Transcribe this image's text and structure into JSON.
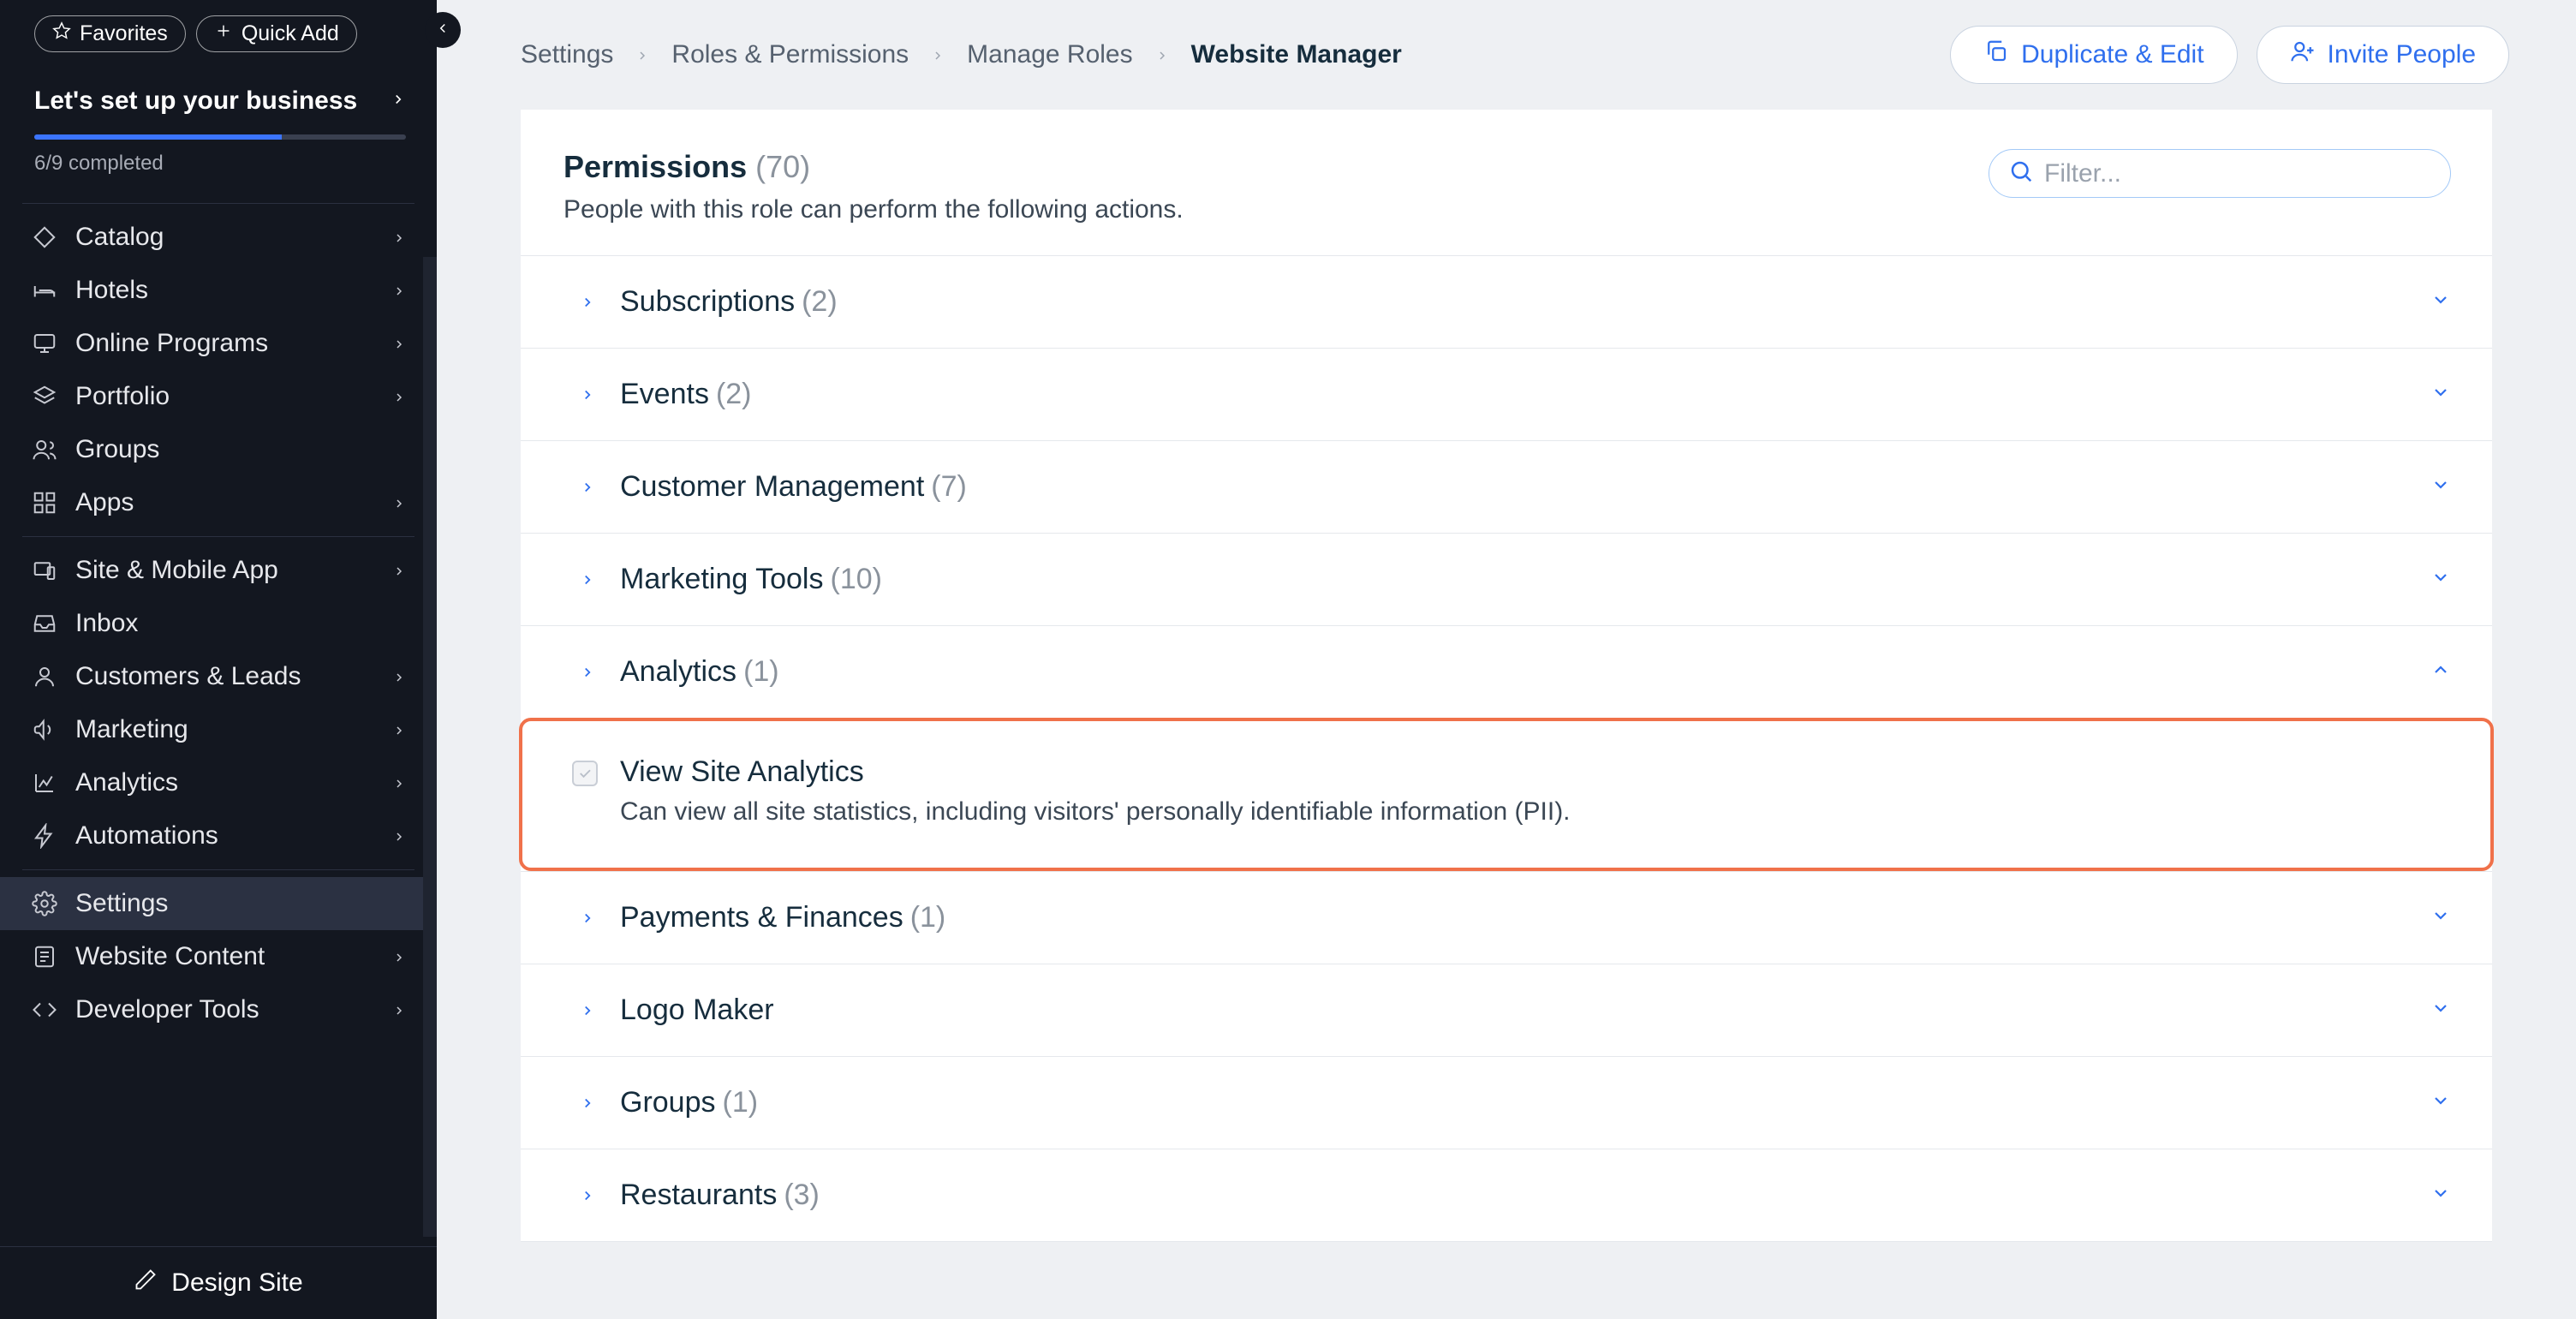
{
  "sidebar": {
    "favorites_label": "Favorites",
    "quick_add_label": "Quick Add",
    "setup": {
      "title": "Let's set up your business",
      "progress_text": "6/9 completed",
      "progress_pct": 66.6
    },
    "group1": [
      {
        "icon": "tag",
        "label": "Catalog",
        "caret": true
      },
      {
        "icon": "bed",
        "label": "Hotels",
        "caret": true
      },
      {
        "icon": "monitor",
        "label": "Online Programs",
        "caret": true
      },
      {
        "icon": "layers",
        "label": "Portfolio",
        "caret": true
      },
      {
        "icon": "users",
        "label": "Groups",
        "caret": false
      },
      {
        "icon": "grid",
        "label": "Apps",
        "caret": true
      }
    ],
    "group2": [
      {
        "icon": "device",
        "label": "Site & Mobile App",
        "caret": true
      },
      {
        "icon": "inbox",
        "label": "Inbox",
        "caret": false
      },
      {
        "icon": "people",
        "label": "Customers & Leads",
        "caret": true
      },
      {
        "icon": "megaphone",
        "label": "Marketing",
        "caret": true
      },
      {
        "icon": "chart",
        "label": "Analytics",
        "caret": true
      },
      {
        "icon": "bolt",
        "label": "Automations",
        "caret": true
      }
    ],
    "group3": [
      {
        "icon": "gear",
        "label": "Settings",
        "caret": false,
        "active": true
      },
      {
        "icon": "page",
        "label": "Website Content",
        "caret": true
      },
      {
        "icon": "code",
        "label": "Developer Tools",
        "caret": true
      }
    ],
    "design_site_label": "Design Site"
  },
  "header": {
    "breadcrumb": [
      "Settings",
      "Roles & Permissions",
      "Manage Roles",
      "Website Manager"
    ],
    "duplicate_label": "Duplicate & Edit",
    "invite_label": "Invite People"
  },
  "permissions": {
    "title": "Permissions",
    "count": "(70)",
    "subtitle": "People with this role can perform the following actions.",
    "filter_placeholder": "Filter...",
    "groups": [
      {
        "title": "Subscriptions",
        "count": "(2)"
      },
      {
        "title": "Events",
        "count": "(2)"
      },
      {
        "title": "Customer Management",
        "count": "(7)"
      },
      {
        "title": "Marketing Tools",
        "count": "(10)"
      },
      {
        "title": "Analytics",
        "count": "(1)",
        "expanded": true
      },
      {
        "title": "Payments & Finances",
        "count": "(1)"
      },
      {
        "title": "Logo Maker",
        "count": ""
      },
      {
        "title": "Groups",
        "count": "(1)"
      },
      {
        "title": "Restaurants",
        "count": "(3)"
      }
    ],
    "highlighted_item": {
      "title": "View Site Analytics",
      "description": "Can view all site statistics, including visitors' personally identifiable information (PII)."
    }
  }
}
